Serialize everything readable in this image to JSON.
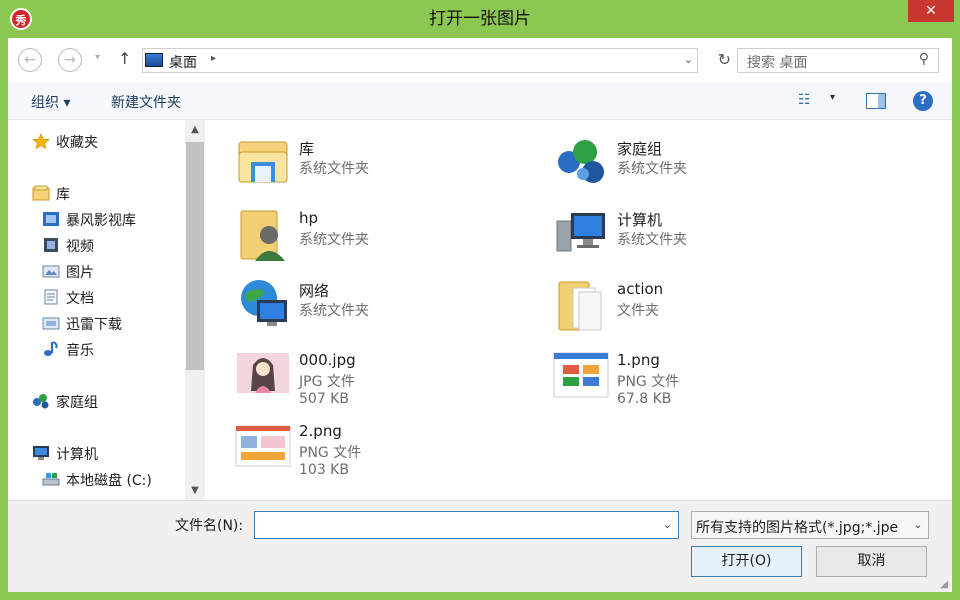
{
  "window": {
    "title": "打开一张图片",
    "app_icon_text": "秀",
    "close_glyph": "✕"
  },
  "nav": {
    "back_glyph": "←",
    "forward_glyph": "→",
    "recent_glyph": "▾",
    "up_glyph": "↑",
    "address_crumb": "桌面",
    "crumb_arrow": "▸",
    "address_dropdown": "⌄",
    "refresh_glyph": "↻",
    "search_placeholder": "搜索 桌面",
    "search_glyph": "⚲"
  },
  "toolbar": {
    "organize_label": "组织 ▾",
    "new_folder_label": "新建文件夹",
    "view_glyph": "☷",
    "view_drop_glyph": "▾",
    "help_glyph": "?"
  },
  "sidebar": {
    "favorites": "收藏夹",
    "library": "库",
    "library_items": [
      "暴风影视库",
      "视频",
      "图片",
      "文档",
      "迅雷下载",
      "音乐"
    ],
    "homegroup": "家庭组",
    "computer": "计算机",
    "local_disk": "本地磁盘 (C:)",
    "scroll_up": "▲",
    "scroll_down": "▼"
  },
  "files": [
    {
      "name": "库",
      "type": "系统文件夹",
      "size": ""
    },
    {
      "name": "家庭组",
      "type": "系统文件夹",
      "size": ""
    },
    {
      "name": "hp",
      "type": "系统文件夹",
      "size": ""
    },
    {
      "name": "计算机",
      "type": "系统文件夹",
      "size": ""
    },
    {
      "name": "网络",
      "type": "系统文件夹",
      "size": ""
    },
    {
      "name": "action",
      "type": "文件夹",
      "size": ""
    },
    {
      "name": "000.jpg",
      "type": "JPG 文件",
      "size": "507 KB"
    },
    {
      "name": "1.png",
      "type": "PNG 文件",
      "size": "67.8 KB"
    },
    {
      "name": "2.png",
      "type": "PNG 文件",
      "size": "103 KB"
    }
  ],
  "bottom": {
    "filename_label": "文件名(N):",
    "filename_value": "",
    "filename_dropdown": "⌄",
    "filter_value": "所有支持的图片格式(*.jpg;*.jpe",
    "filter_dropdown": "⌄",
    "open_label": "打开(O)",
    "cancel_label": "取消",
    "grip": "◢"
  },
  "colors": {
    "frame": "#8cc751",
    "close": "#c7372f",
    "accent": "#3c7fb1"
  }
}
